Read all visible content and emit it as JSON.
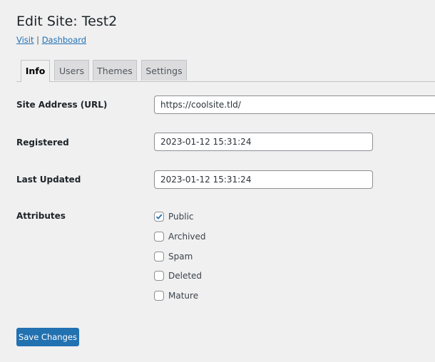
{
  "header": {
    "title": "Edit Site: Test2",
    "links": [
      "Visit",
      "Dashboard"
    ],
    "separator": "|"
  },
  "tabs": [
    {
      "label": "Info",
      "active": true
    },
    {
      "label": "Users"
    },
    {
      "label": "Themes"
    },
    {
      "label": "Settings"
    }
  ],
  "fields": {
    "site_address": {
      "label": "Site Address (URL)",
      "value": "https://coolsite.tld/"
    },
    "registered": {
      "label": "Registered",
      "value": "2023-01-12 15:31:24"
    },
    "last_updated": {
      "label": "Last Updated",
      "value": "2023-01-12 15:31:24"
    }
  },
  "attributes": {
    "label": "Attributes",
    "items": [
      {
        "label": "Public",
        "checked": true
      },
      {
        "label": "Archived",
        "checked": false
      },
      {
        "label": "Spam",
        "checked": false
      },
      {
        "label": "Deleted",
        "checked": false
      },
      {
        "label": "Mature",
        "checked": false
      }
    ]
  },
  "save_label": "Save Changes",
  "colors": {
    "accent": "#2271b1",
    "background": "#f0f0f1"
  }
}
